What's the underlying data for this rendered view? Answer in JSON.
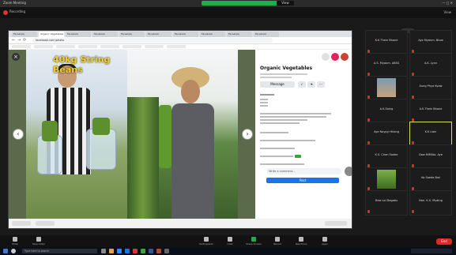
{
  "titlebar": {
    "app": "Zoom Meeting",
    "view_label": "View"
  },
  "zoom_header": {
    "recording": "Recording"
  },
  "browser": {
    "tabs": [
      "Facebook",
      "Organic Vegetables",
      "Facebook",
      "Facebook",
      "Facebook",
      "Facebook",
      "Facebook",
      "Facebook",
      "Facebook",
      "Facebook"
    ],
    "url": "facebook.com/photo",
    "viewer": {
      "caption": "40kg String Beans",
      "prev": "‹",
      "next": "›",
      "close": "×"
    },
    "panel": {
      "page_name": "Organic Vegetables",
      "message_button": "Message",
      "more_button": "···",
      "share_button": "➜",
      "like_button": "✓",
      "comment_placeholder": "Write a comment...",
      "post_button": "Post"
    }
  },
  "participants": [
    {
      "name": "K.K Thein Bhone",
      "speaking": false
    },
    {
      "name": "Aye Myanm. Bhoe",
      "speaking": false
    },
    {
      "name": "A.S. Myanm. ABSS",
      "speaking": false
    },
    {
      "name": "A.K. Lynn",
      "speaking": false
    },
    {
      "name": "",
      "speaking": false,
      "has_image": true
    },
    {
      "name": "Aung Phyo Kyaw",
      "speaking": false
    },
    {
      "name": "A.K.Saing",
      "speaking": false
    },
    {
      "name": "A.K Thein Bhone",
      "speaking": false
    },
    {
      "name": "Aye Naypyi Hlaing",
      "speaking": false
    },
    {
      "name": "K.K Lwin",
      "speaking": true
    },
    {
      "name": "K.S. Chan Sadee",
      "speaking": false
    },
    {
      "name": "Daw MiMiAo. Aye",
      "speaking": false
    },
    {
      "name": "",
      "speaking": false,
      "has_image": true
    },
    {
      "name": "Ko Saeda Bwi",
      "speaking": false
    },
    {
      "name": "Daw Lai Dagabu",
      "speaking": false
    },
    {
      "name": "Nan. K.S. Myaing",
      "speaking": false
    }
  ],
  "controls": [
    {
      "label": "Mute",
      "icon": "microphone-icon"
    },
    {
      "label": "Stop Video",
      "icon": "video-icon"
    },
    {
      "label": "Participants",
      "icon": "people-icon"
    },
    {
      "label": "Chat",
      "icon": "chat-icon"
    },
    {
      "label": "Share Screen",
      "icon": "share-screen-icon"
    },
    {
      "label": "Record",
      "icon": "record-icon"
    },
    {
      "label": "Reactions",
      "icon": "reactions-icon"
    },
    {
      "label": "Apps",
      "icon": "apps-icon"
    }
  ],
  "end_button": "End",
  "taskbar": {
    "search_placeholder": "Type here to search"
  },
  "colors": {
    "zoom_green": "#1fae4b",
    "facebook_blue": "#1b74e4",
    "end_red": "#e02828",
    "speaker_highlight": "#d9e44a",
    "caption_yellow": "#f2cf2a"
  }
}
